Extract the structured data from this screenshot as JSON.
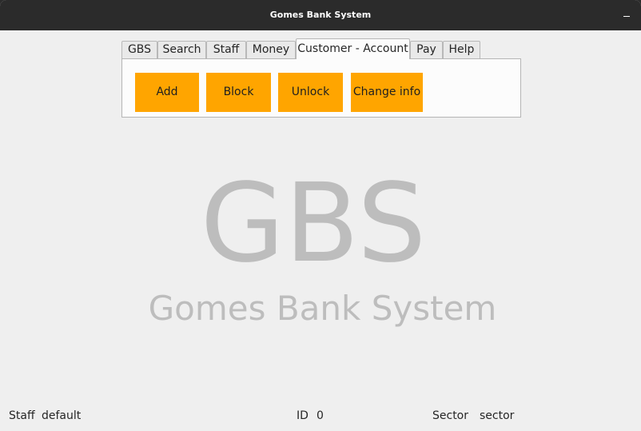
{
  "window": {
    "title": "Gomes Bank System"
  },
  "tabs": [
    {
      "label": "GBS"
    },
    {
      "label": "Search"
    },
    {
      "label": "Staff"
    },
    {
      "label": "Money"
    },
    {
      "label": "Customer - Account",
      "active": true
    },
    {
      "label": "Pay"
    },
    {
      "label": "Help"
    }
  ],
  "buttons": {
    "add": "Add",
    "block": "Block",
    "unlock": "Unlock",
    "change_info": "Change info"
  },
  "logo": {
    "big": "GBS",
    "sub": "Gomes Bank System"
  },
  "status": {
    "staff_label": "Staff",
    "staff_value": "default",
    "id_label": "ID",
    "id_value": "0",
    "sector_label": "Sector",
    "sector_value": "sector"
  },
  "colors": {
    "accent": "#ffa500",
    "titlebar": "#2b2b2b",
    "background": "#efefef",
    "logo": "#bdbdbd"
  }
}
